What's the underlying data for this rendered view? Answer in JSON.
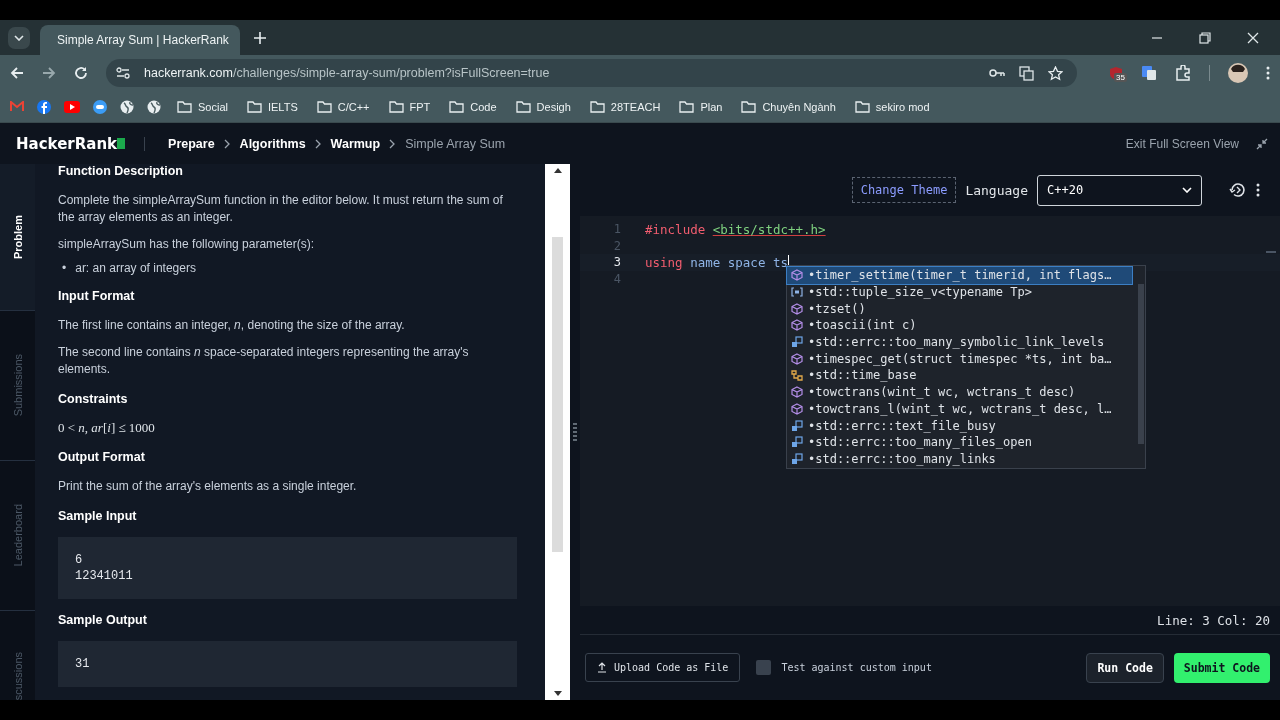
{
  "browser": {
    "tab_title": "Simple Array Sum | HackerRank",
    "url_domain": "hackerrank.com",
    "url_path": "/challenges/simple-array-sum/problem?isFullScreen=true",
    "extension_badge": "35",
    "bookmarks": [
      {
        "label": "Social"
      },
      {
        "label": "IELTS"
      },
      {
        "label": "C/C++"
      },
      {
        "label": "FPT"
      },
      {
        "label": "Code"
      },
      {
        "label": "Desigh"
      },
      {
        "label": "28TEACH"
      },
      {
        "label": "Plan"
      },
      {
        "label": "Chuyên Ngành"
      },
      {
        "label": "sekiro mod"
      }
    ]
  },
  "header": {
    "logo": "HackerRank",
    "breadcrumbs": [
      {
        "label": "Prepare",
        "current": false
      },
      {
        "label": "Algorithms",
        "current": false
      },
      {
        "label": "Warmup",
        "current": false
      },
      {
        "label": "Simple Array Sum",
        "current": true
      }
    ],
    "exit_label": "Exit Full Screen View"
  },
  "side_tabs": [
    {
      "label": "Problem",
      "selected": true
    },
    {
      "label": "Submissions",
      "selected": false
    },
    {
      "label": "Leaderboard",
      "selected": false
    },
    {
      "label": "scussions",
      "selected": false
    }
  ],
  "problem": [
    {
      "kind": "heading",
      "text": "Function Description"
    },
    {
      "kind": "paragraph",
      "text": "Complete the simpleArraySum function in the editor below. It must return the sum of the array elements as an integer."
    },
    {
      "kind": "paragraph",
      "text": "simpleArraySum has the following parameter(s):"
    },
    {
      "kind": "bullet",
      "marker": "•",
      "text": "ar: an array of integers"
    },
    {
      "kind": "heading",
      "text": "Input Format"
    },
    {
      "kind": "paragraph",
      "text": "The first line contains an integer, *n*, denoting the size of the array."
    },
    {
      "kind": "paragraph",
      "text": "The second line contains *n* space-separated integers representing the array's elements."
    },
    {
      "kind": "heading",
      "text": "Constraints"
    },
    {
      "kind": "math",
      "text": "0 < *n*, *ar*[*i*] ≤ 1000"
    },
    {
      "kind": "heading",
      "text": "Output Format"
    },
    {
      "kind": "paragraph",
      "text": "Print the sum of the array's elements as a single integer."
    },
    {
      "kind": "heading",
      "text": "Sample Input"
    },
    {
      "kind": "code",
      "lines": [
        "6",
        "12341011"
      ]
    },
    {
      "kind": "heading",
      "text": "Sample Output"
    },
    {
      "kind": "code",
      "lines": [
        "31"
      ]
    }
  ],
  "editor": {
    "change_theme": "Change Theme",
    "language_label": "Language",
    "language": "C++20",
    "lines": [
      {
        "number": "1",
        "active": false,
        "tokens": [
          {
            "kind": "keyword",
            "text": "#include"
          },
          {
            "kind": "string",
            "text": "<bits/stdc++.h>"
          }
        ]
      },
      {
        "number": "2",
        "active": false
      },
      {
        "number": "3",
        "active": true,
        "tokens": [
          {
            "kind": "keyword",
            "text": "using"
          },
          {
            "kind": "ident",
            "text": " name space ts"
          }
        ]
      },
      {
        "number": "4",
        "active": false
      }
    ],
    "suggestions": [
      {
        "kind": "method",
        "text": "•timer_settime(timer_t timerid, int flags…",
        "selected": true
      },
      {
        "kind": "variable",
        "text": "•std::tuple_size_v<typename Tp>",
        "selected": false
      },
      {
        "kind": "method",
        "text": "•tzset()",
        "selected": false
      },
      {
        "kind": "method",
        "text": "•toascii(int c)",
        "selected": false
      },
      {
        "kind": "enum",
        "text": "•std::errc::too_many_symbolic_link_levels",
        "selected": false
      },
      {
        "kind": "method",
        "text": "•timespec_get(struct timespec *ts, int ba…",
        "selected": false
      },
      {
        "kind": "type",
        "text": "•std::time_base",
        "selected": false
      },
      {
        "kind": "method",
        "text": "•towctrans(wint_t wc, wctrans_t desc)",
        "selected": false
      },
      {
        "kind": "method",
        "text": "•towctrans_l(wint_t wc, wctrans_t desc, l…",
        "selected": false
      },
      {
        "kind": "enum",
        "text": "•std::errc::text_file_busy",
        "selected": false
      },
      {
        "kind": "enum",
        "text": "•std::errc::too_many_files_open",
        "selected": false
      },
      {
        "kind": "enum",
        "text": "•std::errc::too_many_links",
        "selected": false
      }
    ],
    "status": "Line: 3 Col: 20",
    "upload_label": "Upload Code as File",
    "custom_input": {
      "label": "Test against custom input",
      "checked": false
    },
    "run_label": "Run Code",
    "submit_label": "Submit Code"
  }
}
